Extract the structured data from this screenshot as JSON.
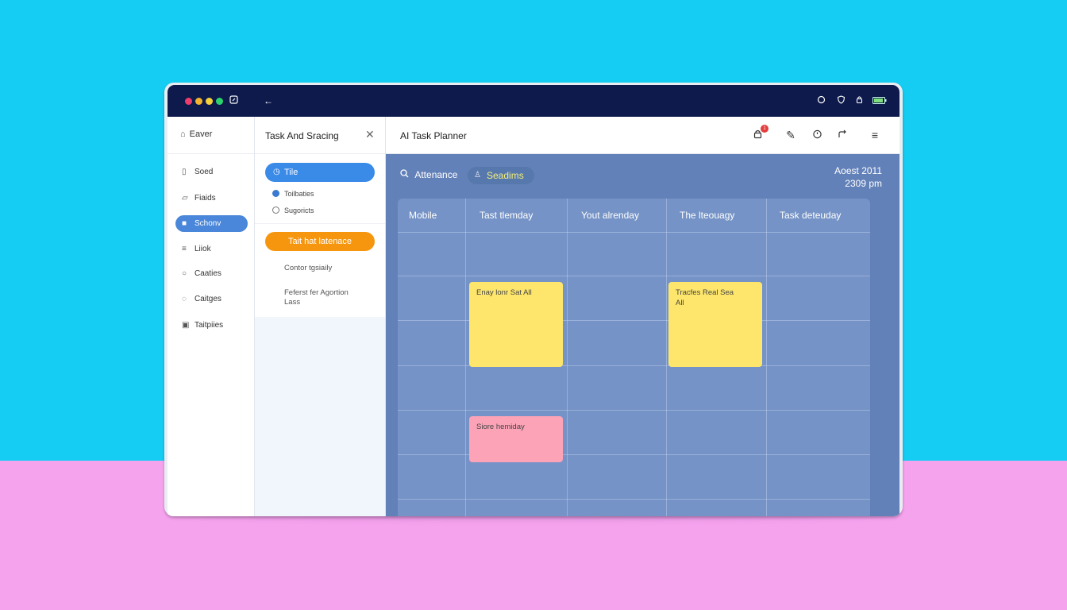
{
  "window": {
    "traffic_lights": [
      "#ec3d6b",
      "#f2b52d",
      "#f6d23b",
      "#2bd46b"
    ],
    "titlebar_icons": [
      "window-icon",
      "back-arrow-icon",
      "chat-icon",
      "shield-icon",
      "lock-icon",
      "battery-icon"
    ]
  },
  "sidebar": {
    "top_label": "Eaver",
    "items": [
      {
        "label": "Soed",
        "icon": "document-icon"
      },
      {
        "label": "Fiaids",
        "icon": "folder-icon"
      },
      {
        "label": "Schonv",
        "icon": "grid-icon",
        "active": true
      },
      {
        "label": "Liiok",
        "icon": "list-icon"
      },
      {
        "label": "Caaties",
        "icon": "chat-icon"
      },
      {
        "label": "Caitges",
        "icon": "message-icon"
      },
      {
        "label": "Taitpiies",
        "icon": "calendar-icon"
      }
    ]
  },
  "panel": {
    "title": "Task And Sracing",
    "title_pill": "Tile",
    "options": [
      {
        "label": "Toilbaties",
        "selected": true
      },
      {
        "label": "Sugoricts",
        "selected": false
      }
    ],
    "action_button": "Tait hat latenace",
    "items": [
      "Contor tgsiaily",
      "Feferst fer Agortion Lass"
    ]
  },
  "header": {
    "title": "AI Task Planner",
    "notification_count": "1"
  },
  "toolbar": {
    "search_label": "Attenance",
    "chip_label": "Seadims",
    "date_line1": "Aoest 2011",
    "date_line2": "2309 pm"
  },
  "board": {
    "columns": [
      "Mobile",
      "Tast tlemday",
      "Yout alrenday",
      "The lteouagy",
      "Task deteuday"
    ],
    "notes": [
      {
        "text": "Enay lonr Sat All",
        "color": "yellow"
      },
      {
        "text": "Tracfes Real Sea All",
        "color": "yellow"
      },
      {
        "text": "Siore hemiday",
        "color": "pink"
      }
    ]
  },
  "colors": {
    "accent_blue": "#3a8ae8",
    "accent_orange": "#f6960e",
    "board_bg": "#6381b9",
    "note_yellow": "#fde66b",
    "note_pink": "#fca3b7"
  }
}
